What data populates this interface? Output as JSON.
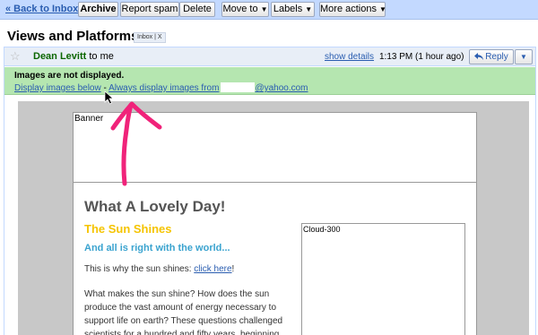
{
  "toolbar": {
    "back_link": "« Back to Inbox",
    "archive": "Archive",
    "report_spam": "Report spam",
    "delete": "Delete",
    "move_to": "Move to",
    "labels": "Labels",
    "more_actions": "More actions"
  },
  "message": {
    "subject": "Views and Platforms",
    "label_chip": "Inbox | X",
    "sender_name": "Dean Levitt",
    "recipient": "to me",
    "show_details": "show details",
    "date": "1:13 PM (1 hour ago)",
    "reply": "Reply"
  },
  "image_warning": {
    "title": "Images are not displayed.",
    "display_below": "Display images below",
    "separator": " - ",
    "always_display": "Always display images from",
    "email_domain": "@yahoo.com"
  },
  "email_body": {
    "banner_placeholder": "Banner",
    "heading": "What A Lovely Day!",
    "subheading": "The Sun Shines",
    "tagline": "And all is right with the world...",
    "why_prefix": "This is why the sun shines: ",
    "why_link": "click here",
    "why_suffix": "!",
    "paragraph": "What makes the sun shine? How does the sun produce the vast amount of energy necessary to support life on earth? These questions challenged scientists for a hundred and fifty years, beginning",
    "cloud_placeholder": "Cloud-300"
  },
  "colors": {
    "toolbar_bg": "#c3d9ff",
    "warning_bg": "#b5e6b0",
    "link": "#2a5db0",
    "heading_yellow": "#f5c400",
    "heading_blue": "#3aa3cf",
    "annotation_arrow": "#f0237a"
  },
  "icons": {
    "star": "star-icon",
    "reply": "reply-arrow-icon",
    "dropdown": "chevron-down-icon",
    "cursor": "mouse-pointer-icon",
    "arrow": "annotation-arrow-icon"
  }
}
